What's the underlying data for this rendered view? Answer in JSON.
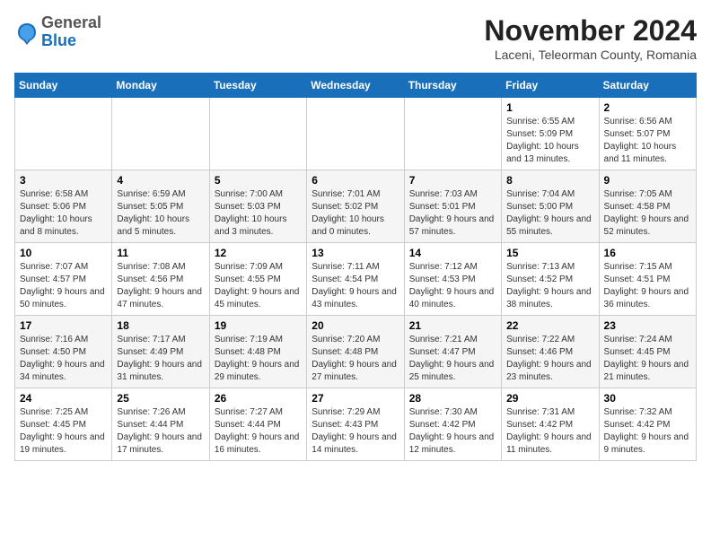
{
  "header": {
    "logo_general": "General",
    "logo_blue": "Blue",
    "month_title": "November 2024",
    "subtitle": "Laceni, Teleorman County, Romania"
  },
  "weekdays": [
    "Sunday",
    "Monday",
    "Tuesday",
    "Wednesday",
    "Thursday",
    "Friday",
    "Saturday"
  ],
  "weeks": [
    [
      {
        "day": "",
        "info": ""
      },
      {
        "day": "",
        "info": ""
      },
      {
        "day": "",
        "info": ""
      },
      {
        "day": "",
        "info": ""
      },
      {
        "day": "",
        "info": ""
      },
      {
        "day": "1",
        "info": "Sunrise: 6:55 AM\nSunset: 5:09 PM\nDaylight: 10 hours and 13 minutes."
      },
      {
        "day": "2",
        "info": "Sunrise: 6:56 AM\nSunset: 5:07 PM\nDaylight: 10 hours and 11 minutes."
      }
    ],
    [
      {
        "day": "3",
        "info": "Sunrise: 6:58 AM\nSunset: 5:06 PM\nDaylight: 10 hours and 8 minutes."
      },
      {
        "day": "4",
        "info": "Sunrise: 6:59 AM\nSunset: 5:05 PM\nDaylight: 10 hours and 5 minutes."
      },
      {
        "day": "5",
        "info": "Sunrise: 7:00 AM\nSunset: 5:03 PM\nDaylight: 10 hours and 3 minutes."
      },
      {
        "day": "6",
        "info": "Sunrise: 7:01 AM\nSunset: 5:02 PM\nDaylight: 10 hours and 0 minutes."
      },
      {
        "day": "7",
        "info": "Sunrise: 7:03 AM\nSunset: 5:01 PM\nDaylight: 9 hours and 57 minutes."
      },
      {
        "day": "8",
        "info": "Sunrise: 7:04 AM\nSunset: 5:00 PM\nDaylight: 9 hours and 55 minutes."
      },
      {
        "day": "9",
        "info": "Sunrise: 7:05 AM\nSunset: 4:58 PM\nDaylight: 9 hours and 52 minutes."
      }
    ],
    [
      {
        "day": "10",
        "info": "Sunrise: 7:07 AM\nSunset: 4:57 PM\nDaylight: 9 hours and 50 minutes."
      },
      {
        "day": "11",
        "info": "Sunrise: 7:08 AM\nSunset: 4:56 PM\nDaylight: 9 hours and 47 minutes."
      },
      {
        "day": "12",
        "info": "Sunrise: 7:09 AM\nSunset: 4:55 PM\nDaylight: 9 hours and 45 minutes."
      },
      {
        "day": "13",
        "info": "Sunrise: 7:11 AM\nSunset: 4:54 PM\nDaylight: 9 hours and 43 minutes."
      },
      {
        "day": "14",
        "info": "Sunrise: 7:12 AM\nSunset: 4:53 PM\nDaylight: 9 hours and 40 minutes."
      },
      {
        "day": "15",
        "info": "Sunrise: 7:13 AM\nSunset: 4:52 PM\nDaylight: 9 hours and 38 minutes."
      },
      {
        "day": "16",
        "info": "Sunrise: 7:15 AM\nSunset: 4:51 PM\nDaylight: 9 hours and 36 minutes."
      }
    ],
    [
      {
        "day": "17",
        "info": "Sunrise: 7:16 AM\nSunset: 4:50 PM\nDaylight: 9 hours and 34 minutes."
      },
      {
        "day": "18",
        "info": "Sunrise: 7:17 AM\nSunset: 4:49 PM\nDaylight: 9 hours and 31 minutes."
      },
      {
        "day": "19",
        "info": "Sunrise: 7:19 AM\nSunset: 4:48 PM\nDaylight: 9 hours and 29 minutes."
      },
      {
        "day": "20",
        "info": "Sunrise: 7:20 AM\nSunset: 4:48 PM\nDaylight: 9 hours and 27 minutes."
      },
      {
        "day": "21",
        "info": "Sunrise: 7:21 AM\nSunset: 4:47 PM\nDaylight: 9 hours and 25 minutes."
      },
      {
        "day": "22",
        "info": "Sunrise: 7:22 AM\nSunset: 4:46 PM\nDaylight: 9 hours and 23 minutes."
      },
      {
        "day": "23",
        "info": "Sunrise: 7:24 AM\nSunset: 4:45 PM\nDaylight: 9 hours and 21 minutes."
      }
    ],
    [
      {
        "day": "24",
        "info": "Sunrise: 7:25 AM\nSunset: 4:45 PM\nDaylight: 9 hours and 19 minutes."
      },
      {
        "day": "25",
        "info": "Sunrise: 7:26 AM\nSunset: 4:44 PM\nDaylight: 9 hours and 17 minutes."
      },
      {
        "day": "26",
        "info": "Sunrise: 7:27 AM\nSunset: 4:44 PM\nDaylight: 9 hours and 16 minutes."
      },
      {
        "day": "27",
        "info": "Sunrise: 7:29 AM\nSunset: 4:43 PM\nDaylight: 9 hours and 14 minutes."
      },
      {
        "day": "28",
        "info": "Sunrise: 7:30 AM\nSunset: 4:42 PM\nDaylight: 9 hours and 12 minutes."
      },
      {
        "day": "29",
        "info": "Sunrise: 7:31 AM\nSunset: 4:42 PM\nDaylight: 9 hours and 11 minutes."
      },
      {
        "day": "30",
        "info": "Sunrise: 7:32 AM\nSunset: 4:42 PM\nDaylight: 9 hours and 9 minutes."
      }
    ]
  ]
}
